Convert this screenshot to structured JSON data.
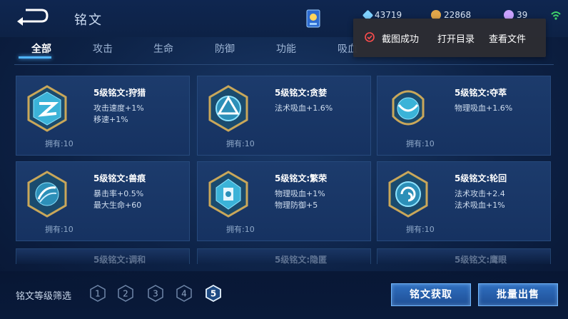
{
  "header": {
    "title": "铭文",
    "resources": [
      {
        "name": "diamond-icon",
        "value": "43719",
        "color": "#7fd1ff"
      },
      {
        "name": "coin-icon",
        "value": "22868",
        "color": "#e0a64a"
      },
      {
        "name": "gem-icon",
        "value": "39",
        "color": "#c9a2ff"
      }
    ]
  },
  "tabs": [
    "全部",
    "攻击",
    "生命",
    "防御",
    "功能",
    "吸血"
  ],
  "active_tab": 0,
  "cards": [
    {
      "name": "5级铭文:狩猎",
      "attrs": [
        "攻击速度+1%",
        "移速+1%"
      ],
      "owned": "拥有:10",
      "icon": "hunt-emblem-icon"
    },
    {
      "name": "5级铭文:贪婪",
      "attrs": [
        "法术吸血+1.6%"
      ],
      "owned": "拥有:10",
      "icon": "greed-emblem-icon"
    },
    {
      "name": "5级铭文:夺萃",
      "attrs": [
        "物理吸血+1.6%"
      ],
      "owned": "拥有:10",
      "icon": "plunder-emblem-icon"
    },
    {
      "name": "5级铭文:兽痕",
      "attrs": [
        "暴击率+0.5%",
        "最大生命+60"
      ],
      "owned": "拥有:10",
      "icon": "beast-emblem-icon"
    },
    {
      "name": "5级铭文:繁荣",
      "attrs": [
        "物理吸血+1%",
        "物理防御+5"
      ],
      "owned": "拥有:10",
      "icon": "prosperity-emblem-icon"
    },
    {
      "name": "5级铭文:轮回",
      "attrs": [
        "法术攻击+2.4",
        "法术吸血+1%"
      ],
      "owned": "拥有:10",
      "icon": "cycle-emblem-icon"
    }
  ],
  "partial_cards": [
    "5级铭文:调和",
    "5级铭文:隐匿",
    "5级铭文:鹰眼"
  ],
  "bottom": {
    "filter_label": "铭文等级筛选",
    "levels": [
      "1",
      "2",
      "3",
      "4",
      "5"
    ],
    "active_level": "5",
    "get_button": "铭文获取",
    "sell_button": "批量出售"
  },
  "toast": {
    "message": "截图成功",
    "open_dir": "打开目录",
    "view_file": "查看文件"
  }
}
